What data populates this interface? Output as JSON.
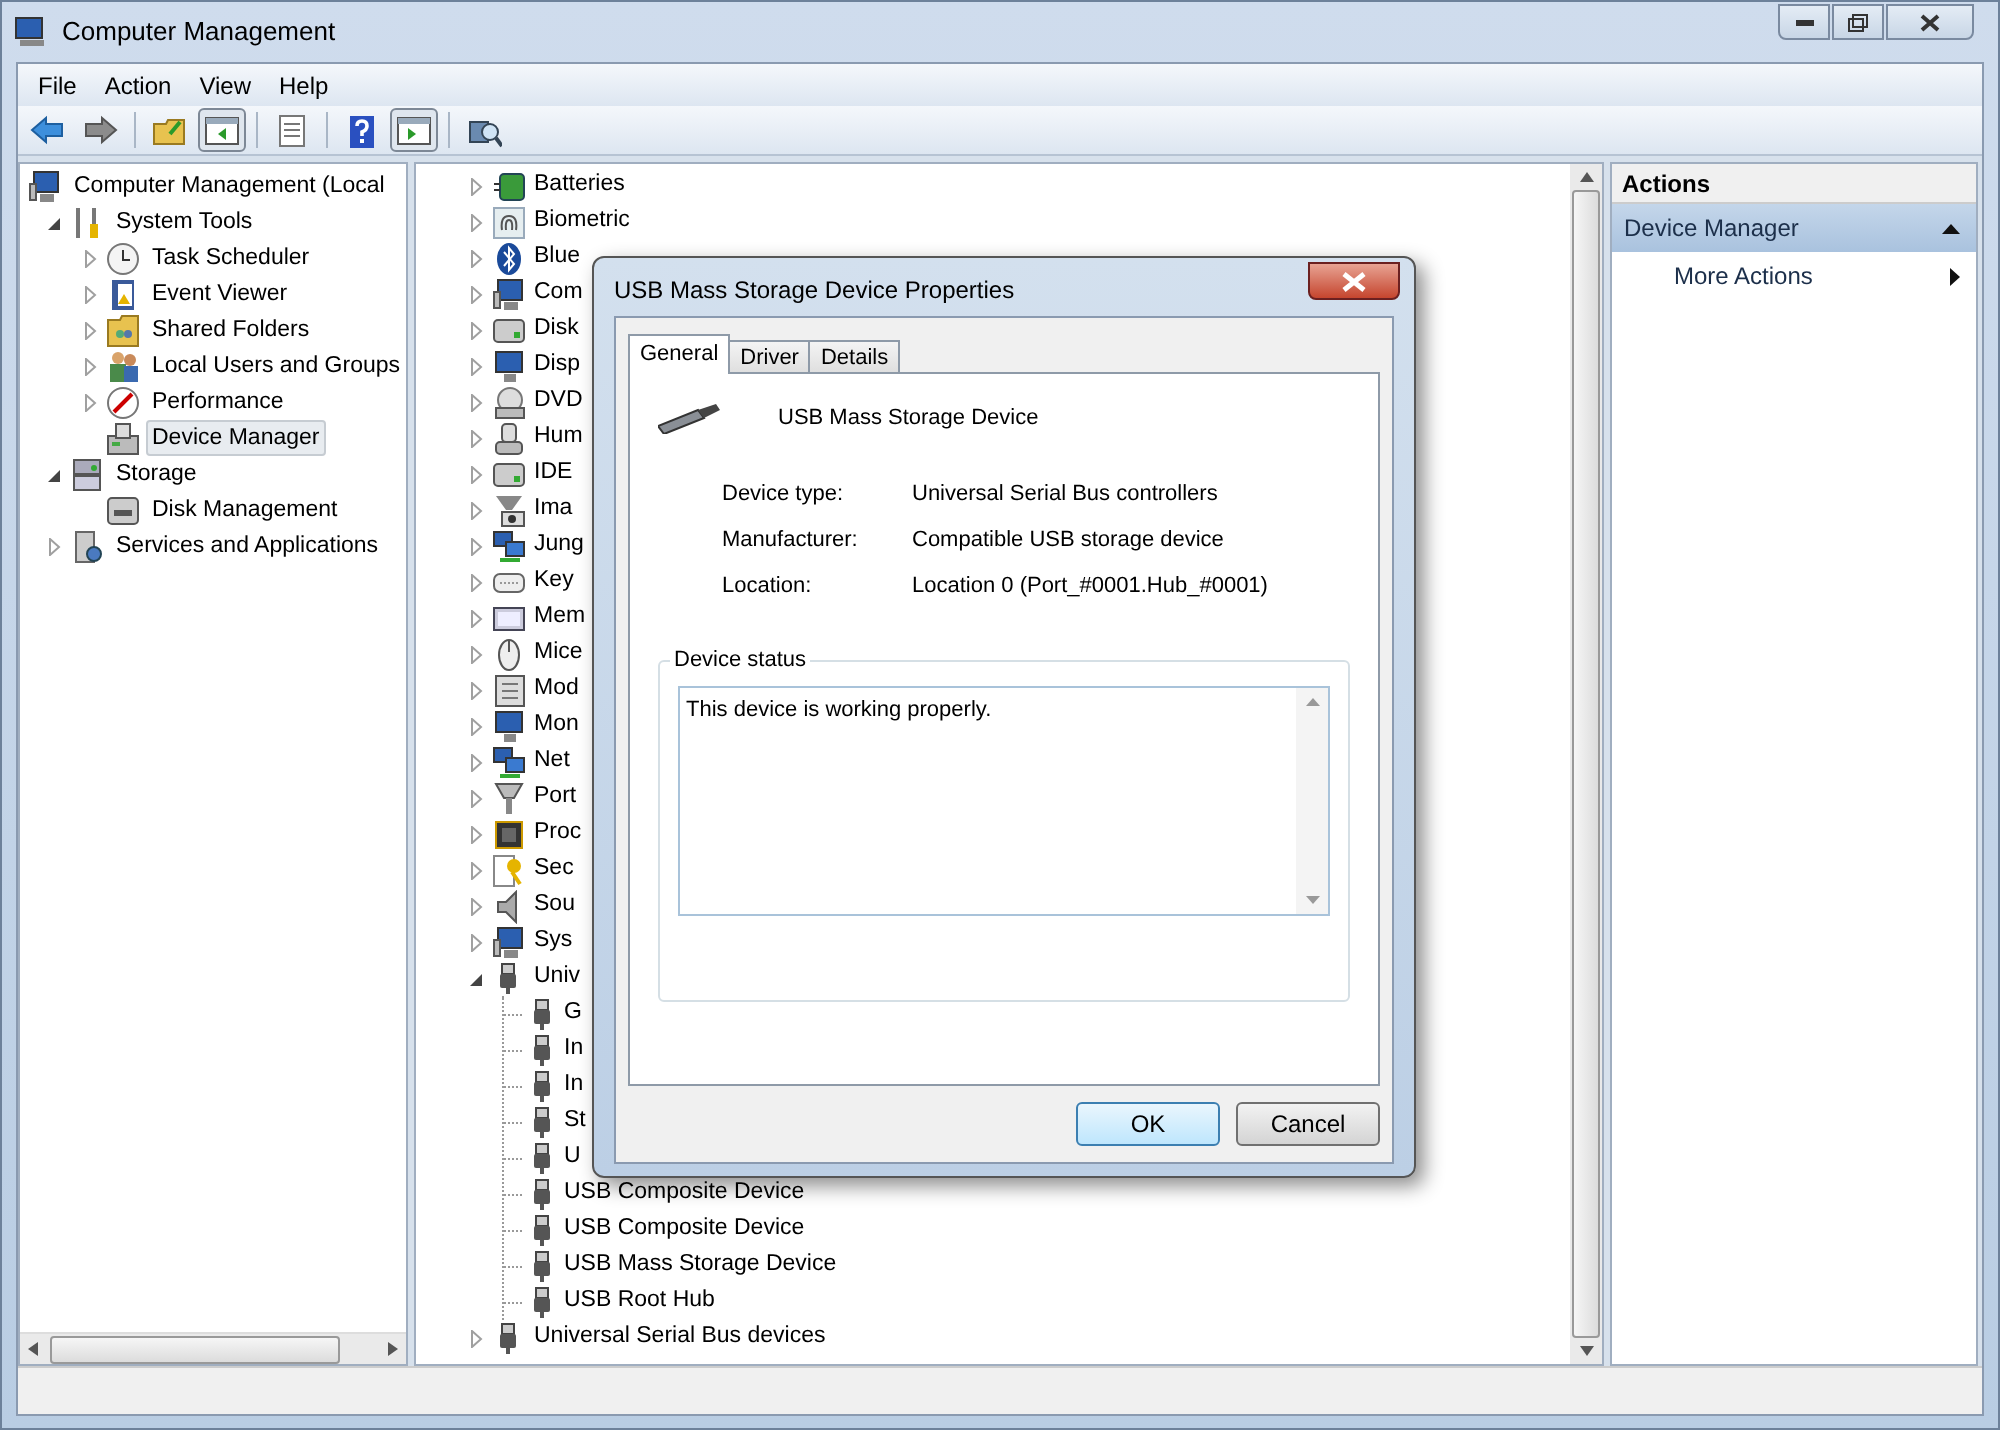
{
  "window": {
    "title": "Computer Management"
  },
  "menu": [
    "File",
    "Action",
    "View",
    "Help"
  ],
  "toolbar": [
    {
      "kind": "back"
    },
    {
      "kind": "forward"
    },
    {
      "kind": "sep"
    },
    {
      "kind": "up"
    },
    {
      "kind": "tree",
      "selected": true
    },
    {
      "kind": "sep"
    },
    {
      "kind": "properties"
    },
    {
      "kind": "sep"
    },
    {
      "kind": "help"
    },
    {
      "kind": "pane",
      "selected": true
    },
    {
      "kind": "sep"
    },
    {
      "kind": "scan"
    }
  ],
  "console_tree": [
    {
      "label": "Computer Management (Local",
      "selected": false,
      "children": [
        {
          "label": "System Tools",
          "expanded": true,
          "selected": false,
          "children": [
            {
              "label": "Task Scheduler",
              "expanded": false,
              "selected": false
            },
            {
              "label": "Event Viewer",
              "expanded": false,
              "selected": false
            },
            {
              "label": "Shared Folders",
              "expanded": false,
              "selected": false
            },
            {
              "label": "Local Users and Groups",
              "expanded": false,
              "selected": false
            },
            {
              "label": "Performance",
              "expanded": false,
              "selected": false
            },
            {
              "label": "Device Manager",
              "selected": true
            }
          ]
        },
        {
          "label": "Storage",
          "expanded": true,
          "selected": false,
          "children": [
            {
              "label": "Disk Management",
              "selected": false
            }
          ]
        },
        {
          "label": "Services and Applications",
          "expanded": false,
          "selected": false
        }
      ]
    }
  ],
  "devices": [
    {
      "label": "Batteries",
      "expanded": false
    },
    {
      "label": "Biometric",
      "expanded": false
    },
    {
      "label": "Blue",
      "expanded": false
    },
    {
      "label": "Com",
      "expanded": false
    },
    {
      "label": "Disk",
      "expanded": false
    },
    {
      "label": "Disp",
      "expanded": false
    },
    {
      "label": "DVD",
      "expanded": false
    },
    {
      "label": "Hum",
      "expanded": false
    },
    {
      "label": "IDE",
      "expanded": false
    },
    {
      "label": "Ima",
      "expanded": false
    },
    {
      "label": "Jung",
      "expanded": false
    },
    {
      "label": "Key",
      "expanded": false
    },
    {
      "label": "Mem",
      "expanded": false
    },
    {
      "label": "Mice",
      "expanded": false
    },
    {
      "label": "Mod",
      "expanded": false
    },
    {
      "label": "Mon",
      "expanded": false
    },
    {
      "label": "Net",
      "expanded": false
    },
    {
      "label": "Port",
      "expanded": false
    },
    {
      "label": "Proc",
      "expanded": false
    },
    {
      "label": "Sec",
      "expanded": false
    },
    {
      "label": "Sou",
      "expanded": false
    },
    {
      "label": "Sys",
      "expanded": false
    },
    {
      "label": "Univ",
      "expanded": true,
      "children": [
        {
          "label": "G"
        },
        {
          "label": "In"
        },
        {
          "label": "In"
        },
        {
          "label": "St"
        },
        {
          "label": "U"
        },
        {
          "label": "USB Composite Device"
        },
        {
          "label": "USB Composite Device"
        },
        {
          "label": "USB Mass Storage Device"
        },
        {
          "label": "USB Root Hub"
        }
      ]
    },
    {
      "label": "Universal Serial Bus devices",
      "expanded": false
    }
  ],
  "actions": {
    "title": "Actions",
    "section": "Device Manager",
    "items": [
      "More Actions"
    ]
  },
  "dialog": {
    "title": "USB Mass Storage Device Properties",
    "tabs": [
      {
        "label": "General",
        "selected": true
      },
      {
        "label": "Driver",
        "selected": false
      },
      {
        "label": "Details",
        "selected": false
      }
    ],
    "device_name": "USB Mass Storage Device",
    "properties": [
      {
        "label": "Device type:",
        "value": "Universal Serial Bus controllers"
      },
      {
        "label": "Manufacturer:",
        "value": "Compatible USB storage device"
      },
      {
        "label": "Location:",
        "value": "Location 0 (Port_#0001.Hub_#0001)"
      }
    ],
    "status_group": "Device status",
    "status_text": "This device is working properly.",
    "buttons": [
      {
        "label": "OK",
        "default": true
      },
      {
        "label": "Cancel",
        "default": false
      }
    ]
  }
}
